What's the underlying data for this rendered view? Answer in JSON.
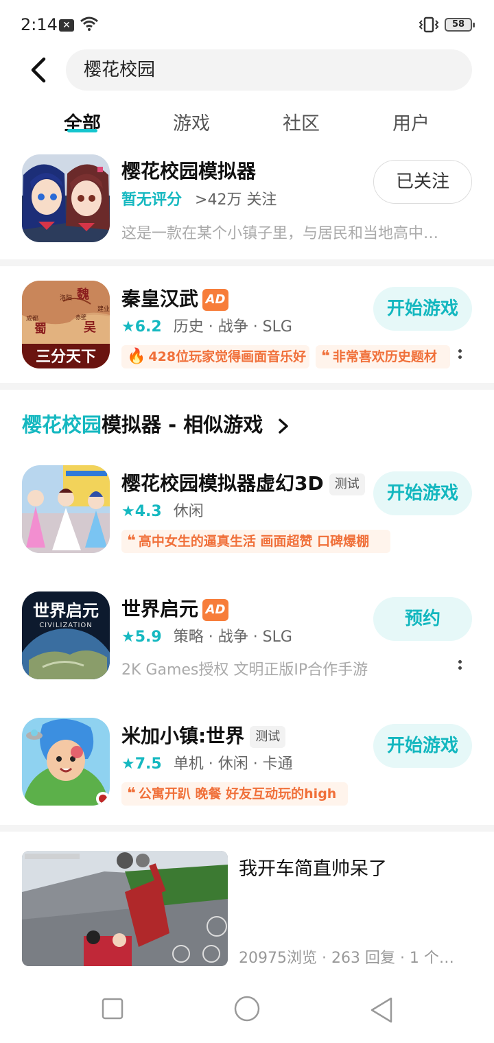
{
  "status_bar": {
    "time": "2:14",
    "notif_glyph": "✕",
    "battery": "58"
  },
  "search": {
    "query": "樱花校园"
  },
  "tabs": [
    {
      "label": "全部"
    },
    {
      "label": "游戏"
    },
    {
      "label": "社区"
    },
    {
      "label": "用户"
    }
  ],
  "apps": {
    "main": {
      "title": "樱花校园模拟器",
      "rating_text": "暂无评分",
      "followers": ">42万 关注",
      "description": "这是一款在某个小镇子里，与居民和当地高中…",
      "button": "已关注"
    },
    "ad1": {
      "title": "秦皇汉武",
      "ad_label": "AD",
      "rating": "6.2",
      "tags": "历史 · 战争 · SLG",
      "quotes": [
        "428位玩家觉得画面音乐好",
        "非常喜欢历史题材"
      ],
      "button": "开始游戏",
      "icon_text": {
        "map_wei": "魏",
        "map_shu": "蜀",
        "map_wu": "吴",
        "map_luoyang": "洛阳",
        "map_chengdu": "成都",
        "map_jianye": "建业",
        "map_chibi": "赤壁",
        "banner": "三分天下"
      }
    }
  },
  "similar": {
    "title_highlight": "樱花校园",
    "title_rest": "模拟器 - 相似游戏",
    "items": [
      {
        "title": "樱花校园模拟器虚幻3D",
        "badge": "测试",
        "rating": "4.3",
        "tags": "休闲",
        "quote": "高中女生的逼真生活 画面超赞 口碑爆棚",
        "button": "开始游戏"
      },
      {
        "title": "世界启元",
        "badge": "AD",
        "rating": "5.9",
        "tags": "策略 · 战争 · SLG",
        "description": "2K Games授权 文明正版IP合作手游",
        "button": "预约",
        "icon_text": {
          "title": "世界启元",
          "subtitle": "CIVILIZATION"
        }
      },
      {
        "title": "米加小镇:世界",
        "badge": "测试",
        "rating": "7.5",
        "tags": "单机 · 休闲 · 卡通",
        "quote": "公寓开趴 晚餐 好友互动玩的high",
        "button": "开始游戏"
      }
    ]
  },
  "post": {
    "title": "我开车简直帅呆了",
    "stats": "20975浏览 · 263 回复 · 1 个…"
  },
  "colors": {
    "accent": "#15c5ce",
    "ad": "#f77d3a",
    "quote": "#f0703a"
  },
  "icons": [
    "back-arrow-icon",
    "wifi-icon",
    "vibrate-icon",
    "battery-icon",
    "star-icon",
    "fire-icon",
    "quote-icon",
    "chevron-right-icon",
    "more-icon",
    "square-icon",
    "circle-icon",
    "triangle-back-icon"
  ]
}
